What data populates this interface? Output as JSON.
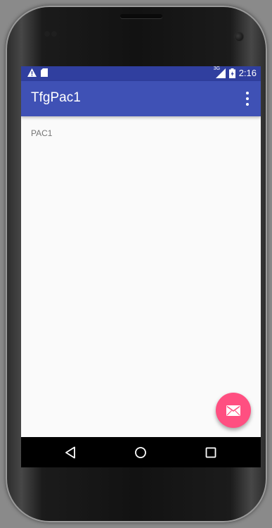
{
  "device": {
    "status_bar": {
      "left_icons": [
        "warning-icon",
        "sd-card-icon"
      ],
      "network_label": "3G",
      "time": "2:16",
      "right_icons": [
        "signal-icon",
        "battery-icon"
      ]
    },
    "app_bar": {
      "title": "TfgPac1",
      "menu_icon": "overflow-menu-icon"
    },
    "content": {
      "text": "PAC1"
    },
    "fab": {
      "icon": "mail-icon",
      "color": "#ff4f81"
    },
    "nav_bar": {
      "buttons": [
        "back-icon",
        "home-icon",
        "recents-icon"
      ]
    },
    "colors": {
      "primary": "#3f51b5",
      "primary_dark": "#303f9f",
      "accent": "#ff4f81"
    }
  }
}
